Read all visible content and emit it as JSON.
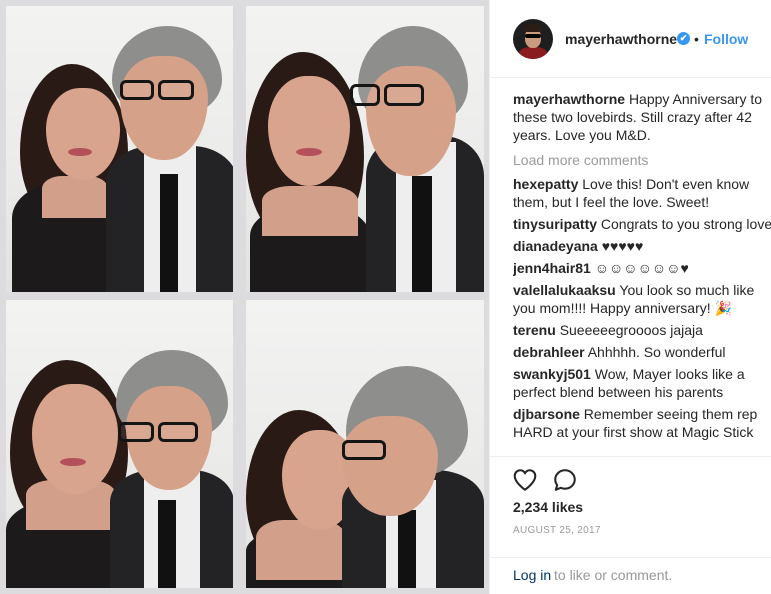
{
  "post": {
    "username": "mayerhawthorne",
    "verified_badge": "✔",
    "separator": "•",
    "follow_label": "Follow",
    "caption_user": "mayerhawthorne",
    "caption_text": "Happy Anniversary to these two lovebirds. Still crazy after 42 years. Love you M&D.",
    "load_more": "Load more comments",
    "comments": [
      {
        "user": "hexepatty",
        "text": "Love this! Don't even know them, but I feel the love. Sweet!"
      },
      {
        "user": "tinysuripatty",
        "text": "Congrats to you strong love"
      },
      {
        "user": "dianadeyana",
        "text": "♥♥♥♥♥"
      },
      {
        "user": "jenn4hair81",
        "text": "☺☺☺☺☺☺♥"
      },
      {
        "user": "valellalukaaksu",
        "text": "You look so much like you mom!!!! Happy anniversary! 🎉"
      },
      {
        "user": "terenu",
        "text": "Sueeeeegroooos jajaja"
      },
      {
        "user": "debrahleer",
        "text": "Ahhhhh. So wonderful"
      },
      {
        "user": "swankyj501",
        "text": "Wow, Mayer looks like a perfect blend between his parents"
      },
      {
        "user": "djbarsone",
        "text": "Remember seeing them rep HARD at your first show at Magic Stick"
      }
    ],
    "likes": "2,234 likes",
    "date": "AUGUST 25, 2017",
    "login_link": "Log in",
    "login_rest": "to like or comment."
  },
  "icons": {
    "like": "heart-icon",
    "comment": "comment-bubble-icon",
    "verified": "verified-badge-icon"
  },
  "colors": {
    "link": "#3897f0",
    "muted": "#999999",
    "login": "#003569",
    "text": "#262626"
  }
}
